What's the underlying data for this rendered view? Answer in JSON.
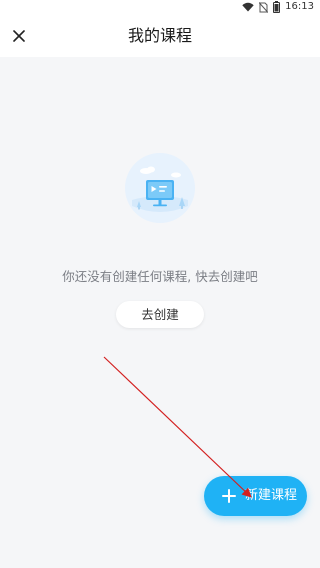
{
  "status_bar": {
    "time": "16:13",
    "icons": [
      "wifi-icon",
      "no-sim-icon",
      "battery-icon"
    ]
  },
  "header": {
    "title": "我的课程",
    "close_icon": "close-icon"
  },
  "empty_state": {
    "illustration": "empty-course-illustration",
    "message": "你还没有创建任何课程, 快去创建吧",
    "create_button_label": "去创建"
  },
  "fab": {
    "label": "新建课程",
    "icon": "plus-icon"
  },
  "colors": {
    "accent": "#1fb2f5",
    "background": "#f5f6f8",
    "annotation_arrow": "#d32020"
  }
}
